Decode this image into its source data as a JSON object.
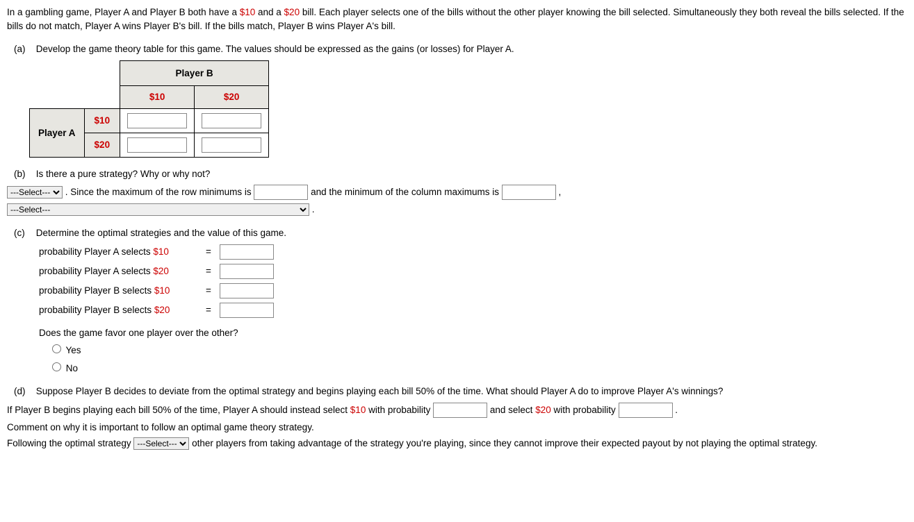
{
  "intro1a": "In a gambling game, Player A and Player B both have a ",
  "intro1b": " and a ",
  "intro1c": " bill. Each player selects one of the bills without the other player knowing the bill selected. Simultaneously they both reveal the bills selected. If the bills do not match, Player A wins Player B's bill. If the bills match, Player B wins Player A's bill.",
  "ten": "$10",
  "twenty": "$20",
  "a": {
    "label": "(a)",
    "text": "Develop the game theory table for this game. The values should be expressed as the gains (or losses) for Player A.",
    "playerA": "Player A",
    "playerB": "Player B"
  },
  "b": {
    "label": "(b)",
    "q": "Is there a pure strategy? Why or why not?",
    "sel": "---Select---",
    "p1": ". Since the maximum of the row minimums is ",
    "p2": " and the minimum of the column maximums is ",
    "comma": ",",
    "period": "."
  },
  "c": {
    "label": "(c)",
    "q": "Determine the optimal strategies and the value of this game.",
    "pA10a": "probability Player A selects ",
    "pA20a": "probability Player A selects ",
    "pB10a": "probability Player B selects ",
    "pB20a": "probability Player B selects ",
    "eq": "=",
    "favor": "Does the game favor one player over the other?",
    "yes": "Yes",
    "no": "No"
  },
  "d": {
    "label": "(d)",
    "q": "Suppose Player B decides to deviate from the optimal strategy and begins playing each bill 50% of the time. What should Player A do to improve Player A's winnings?",
    "l1a": "If Player B begins playing each bill 50% of the time, Player A should instead select ",
    "l1b": " with probability ",
    "l1c": " and select ",
    "l1d": " with probability ",
    "l1e": " .",
    "comment": "Comment on why it is important to follow an optimal game theory strategy.",
    "f1": "Following the optimal strategy ",
    "f2": " other players from taking advantage of the strategy you're playing, since they cannot improve their expected payout by not playing the optimal strategy.",
    "sel": "---Select---"
  }
}
